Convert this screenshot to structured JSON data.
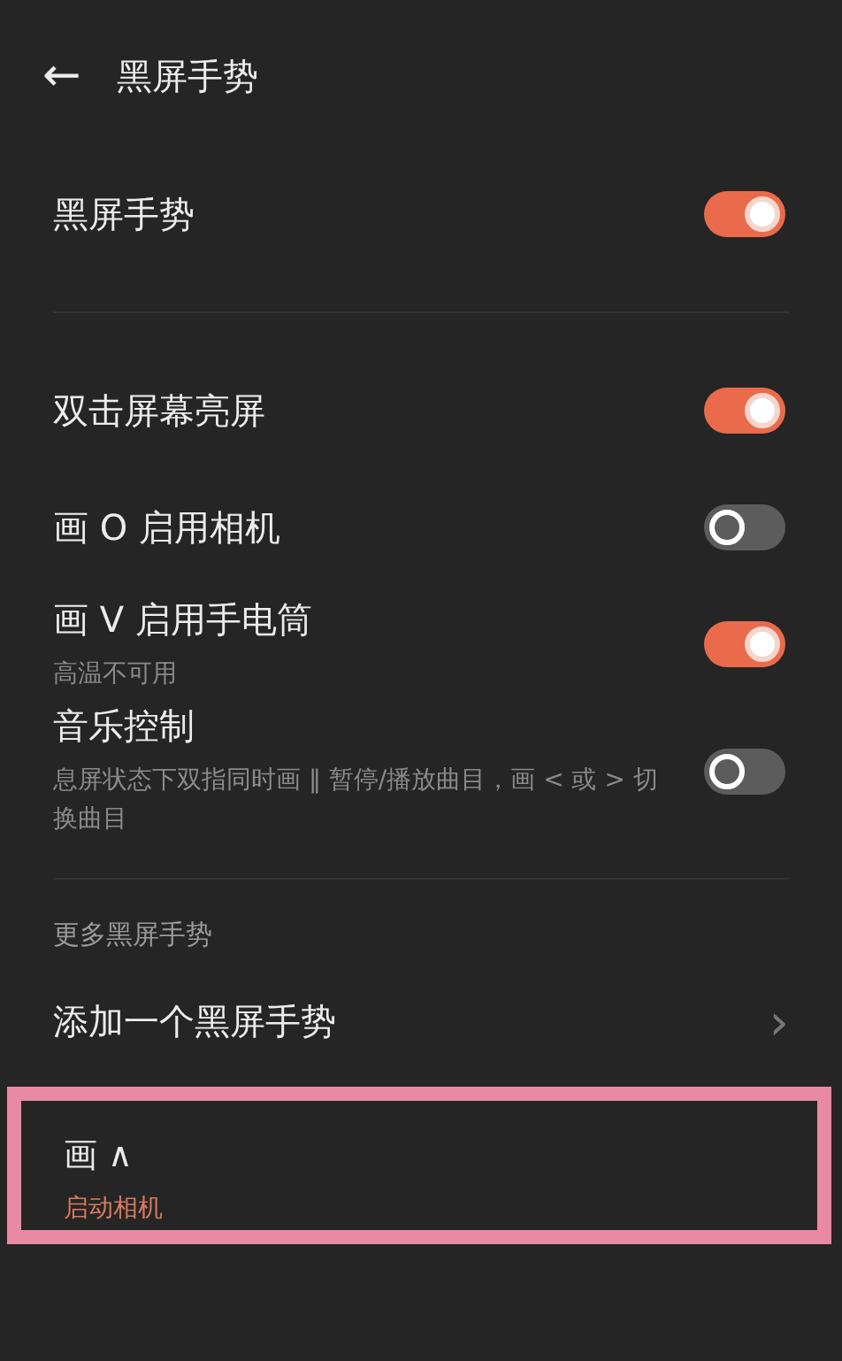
{
  "header": {
    "back_icon": "←",
    "title": "黑屏手势"
  },
  "main_toggle": {
    "label": "黑屏手势",
    "on": true
  },
  "gestures": [
    {
      "label": "双击屏幕亮屏",
      "on": true
    },
    {
      "label": "画 O 启用相机",
      "on": false
    },
    {
      "label": "画 V 启用手电筒",
      "sublabel": "高温不可用",
      "on": true
    },
    {
      "label": "音乐控制",
      "sublabel": "息屏状态下双指同时画 ‖ 暂停/播放曲目，画 < 或 > 切换曲目",
      "on": false
    }
  ],
  "more": {
    "section_title": "更多黑屏手势",
    "add_item": {
      "label": "添加一个黑屏手势",
      "chevron": "›"
    },
    "custom_gestures": [
      {
        "label": "画 ∧",
        "sublabel": "启动相机",
        "highlighted": true
      }
    ]
  }
}
